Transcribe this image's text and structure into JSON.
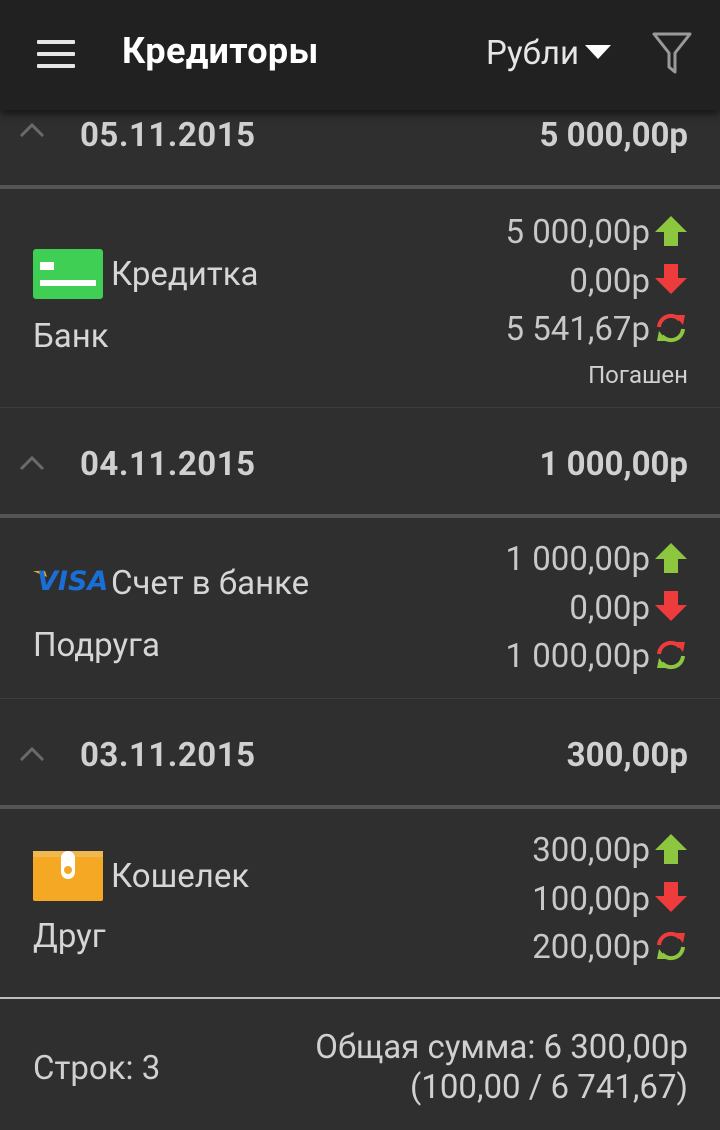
{
  "appbar": {
    "title": "Кредиторы",
    "currency": "Рубли",
    "icons": [
      "menu-icon",
      "chevron-down-icon",
      "filter-icon"
    ]
  },
  "groups": [
    {
      "date": "05.11.2015",
      "total": "5 000,00р",
      "item": {
        "account": "Кредитка",
        "account_icon": "credit-card-icon",
        "person": "Банк",
        "amount_in": "5 000,00р",
        "amount_out": "0,00р",
        "balance": "5 541,67р",
        "status": "Погашен"
      }
    },
    {
      "date": "04.11.2015",
      "total": "1 000,00р",
      "item": {
        "account": "Счет в банке",
        "account_icon": "visa-icon",
        "visa_text": "VISA",
        "person": "Подруга",
        "amount_in": "1 000,00р",
        "amount_out": "0,00р",
        "balance": "1 000,00р"
      }
    },
    {
      "date": "03.11.2015",
      "total": "300,00р",
      "item": {
        "account": "Кошелек",
        "account_icon": "wallet-icon",
        "person": "Друг",
        "amount_in": "300,00р",
        "amount_out": "100,00р",
        "balance": "200,00р"
      }
    }
  ],
  "footer": {
    "rows": "Строк: 3",
    "sum": "Общая сумма: 6 300,00р",
    "sum_detail": "(100,00 / 6 741,67)"
  },
  "colors": {
    "appbar": "#212121",
    "background": "#2f2f2f",
    "arrow_up": "#8dc63f",
    "arrow_down": "#ee3b3b",
    "card_green": "#3ecf54",
    "wallet": "#f5a823",
    "visa_blue": "#1a6fd6",
    "visa_gold": "#f7a823"
  }
}
